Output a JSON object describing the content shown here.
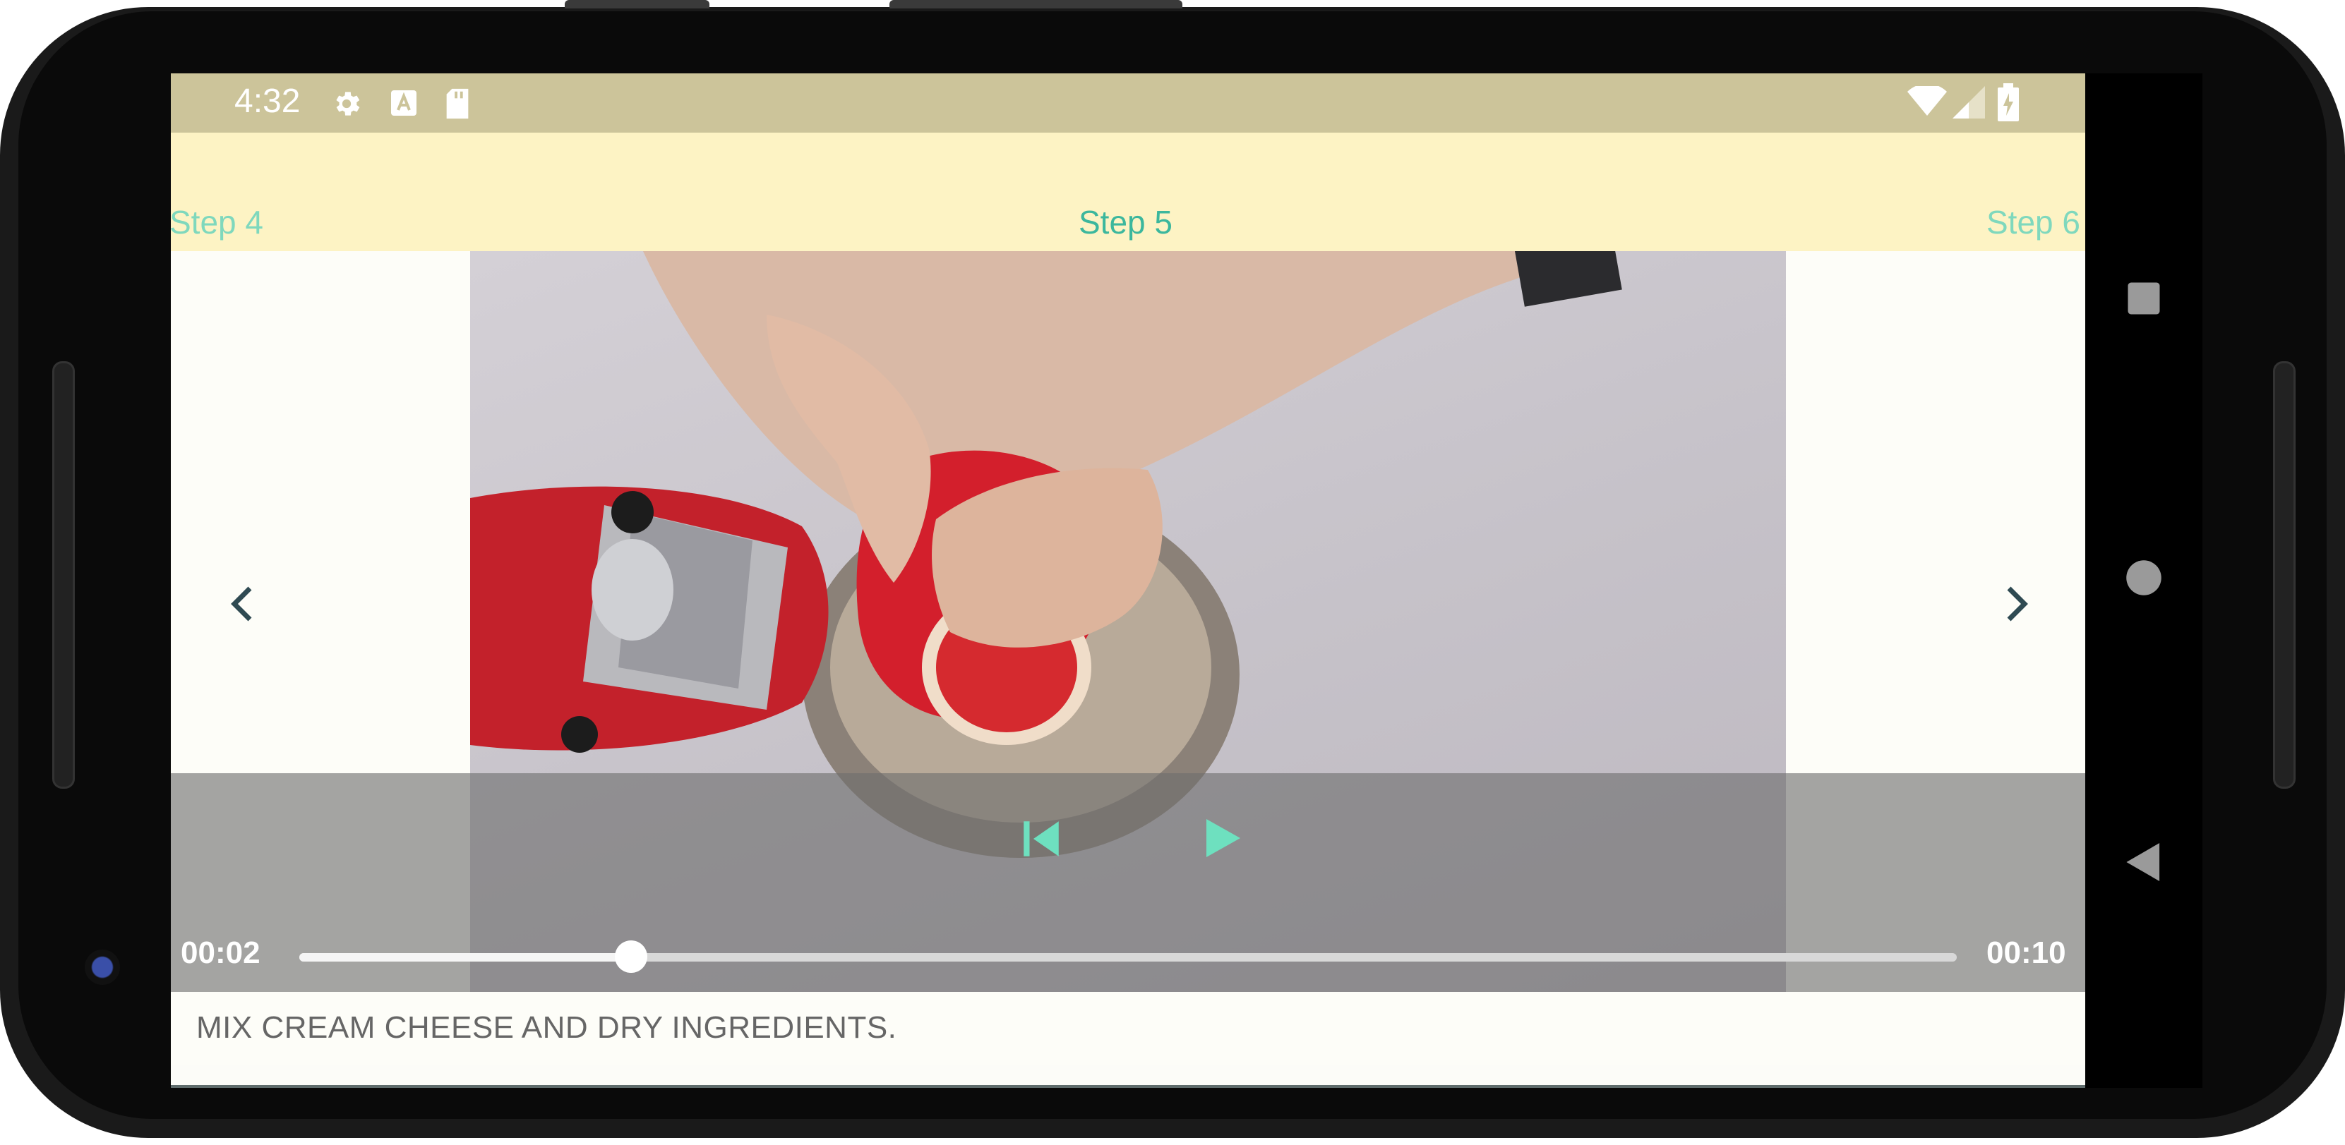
{
  "status_bar": {
    "time": "4:32",
    "icons": [
      "gear-icon",
      "text-a-icon",
      "sd-card-icon",
      "wifi-icon",
      "signal-icon",
      "battery-charging-icon"
    ]
  },
  "tabs": [
    {
      "label": "Step 4",
      "active": false
    },
    {
      "label": "Step 5",
      "active": true
    },
    {
      "label": "Step 6",
      "active": false
    }
  ],
  "player": {
    "position": "00:02",
    "duration": "00:10",
    "progress": 0.2,
    "state": "paused"
  },
  "step_description": "MIX CREAM CHEESE AND DRY INGREDIENTS.",
  "colors": {
    "status_bar": "#ccc49a",
    "tab_strip": "#fdf3c4",
    "tab_active": "#3cb79d",
    "tab_inactive": "#7fd8bd",
    "control_accent": "#6ee0bf",
    "nav_arrow": "#2f4a52"
  },
  "nav_buttons": [
    "recents-square-icon",
    "home-circle-icon",
    "back-triangle-icon"
  ]
}
